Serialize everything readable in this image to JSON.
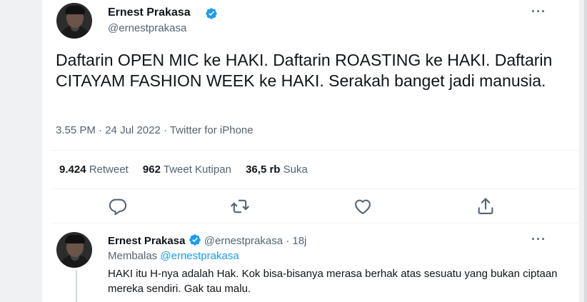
{
  "tweet": {
    "author_name": "Ernest Prakasa",
    "author_handle": "@ernestprakasa",
    "text": "Daftarin OPEN MIC ke HAKI. Daftarin ROASTING ke HAKI. Daftarin CITAYAM FASHION WEEK ke HAKI. Serakah banget jadi manusia.",
    "time": "3.55 PM",
    "date": "24 Jul 2022",
    "source": "Twitter for iPhone",
    "separator": "·",
    "more_label": "···",
    "stats": {
      "retweets_count": "9.424",
      "retweets_label": "Retweet",
      "quotes_count": "962",
      "quotes_label": "Tweet Kutipan",
      "likes_count": "36,5 rb",
      "likes_label": "Suka"
    },
    "actions": [
      "reply-icon",
      "retweet-icon",
      "like-icon",
      "share-icon"
    ]
  },
  "reply": {
    "author_name": "Ernest Prakasa",
    "author_handle": "@ernestprakasa",
    "separator": "·",
    "age": "18j",
    "replying_label": "Membalas",
    "replying_handle": "@ernestprakasa",
    "text": "HAKI itu H-nya adalah Hak. Kok bisa-bisanya merasa berhak atas sesuatu yang bukan ciptaan mereka sendiri. Gak tau malu.",
    "more_label": "···"
  },
  "colors": {
    "accent": "#1d9bf0",
    "secondary_text": "#536471",
    "primary_text": "#0f1419"
  }
}
